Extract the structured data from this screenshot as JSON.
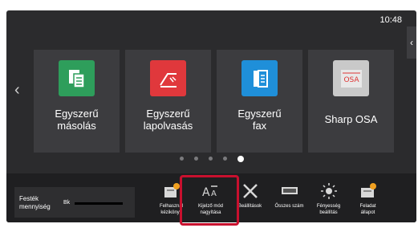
{
  "status": {
    "time": "10:48"
  },
  "apps": [
    {
      "label_line1": "Egyszerű",
      "label_line2": "másolás",
      "icon": "copy-icon",
      "color": "#2e9e5b"
    },
    {
      "label_line1": "Egyszerű",
      "label_line2": "lapolvasás",
      "icon": "scan-icon",
      "color": "#e0383c"
    },
    {
      "label_line1": "Egyszerű",
      "label_line2": "fax",
      "icon": "fax-icon",
      "color": "#1f8fd9"
    },
    {
      "label_line1": "Sharp OSA",
      "label_line2": "",
      "icon": "osa-icon",
      "color": "#c9c9c9"
    }
  ],
  "pager": {
    "count": 5,
    "active": 5
  },
  "toner": {
    "label_line1": "Festék",
    "label_line2": "mennyiség",
    "channel": "Bk"
  },
  "tools": [
    {
      "line1": "Felhasznál",
      "line2": "kézikönyv"
    },
    {
      "line1": "Kijelző mód",
      "line2": "nagyítása"
    },
    {
      "line1": "Beállítások",
      "line2": ""
    },
    {
      "line1": "Összes szám",
      "line2": ""
    },
    {
      "line1": "Fényesség",
      "line2": "beállítás"
    },
    {
      "line1": "Feladat",
      "line2": "állapot"
    }
  ],
  "colors": {
    "highlight": "#c8102e"
  }
}
